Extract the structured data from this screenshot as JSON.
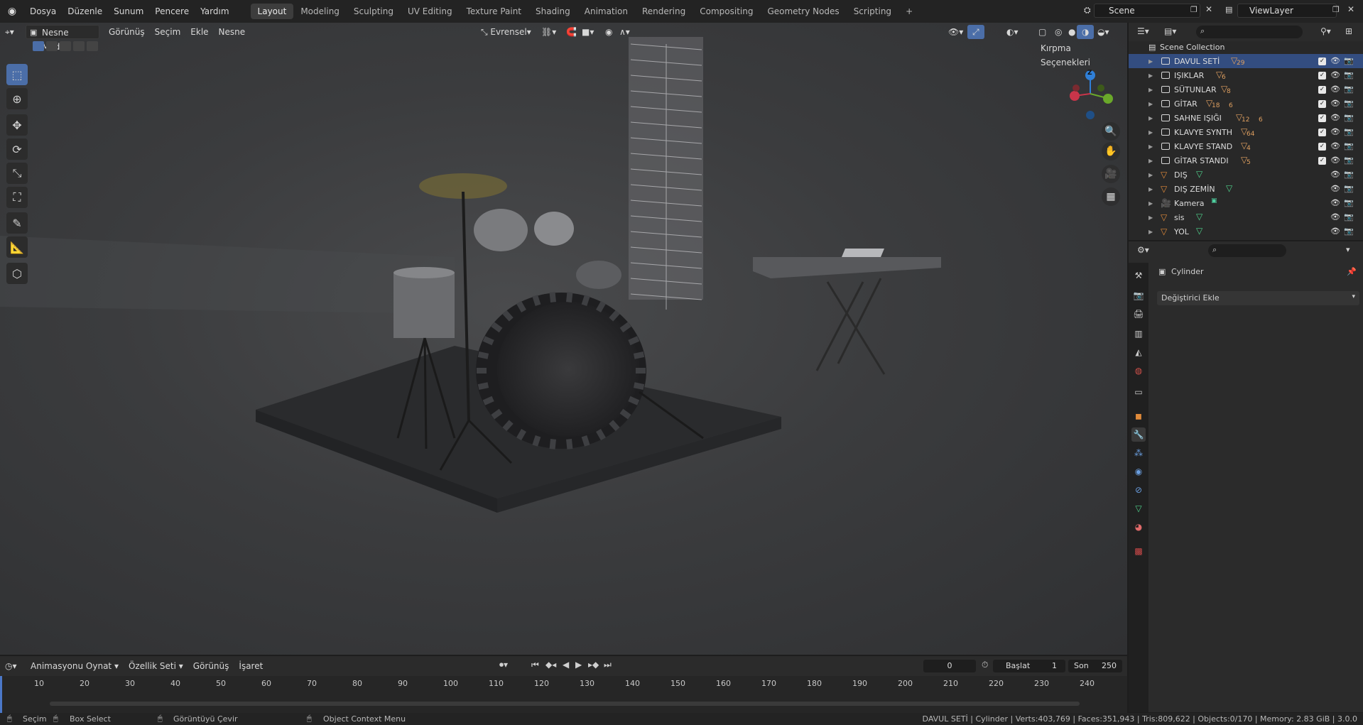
{
  "topbar": {
    "menus": [
      "Dosya",
      "Düzenle",
      "Sunum",
      "Pencere",
      "Yardım"
    ],
    "workspaces": [
      "Layout",
      "Modeling",
      "Sculpting",
      "UV Editing",
      "Texture Paint",
      "Shading",
      "Animation",
      "Rendering",
      "Compositing",
      "Geometry Nodes",
      "Scripting"
    ],
    "active_workspace": "Layout",
    "add_tab": "+",
    "scene": "Scene",
    "view_layer": "ViewLayer"
  },
  "viewport": {
    "mode": "Nesne Modu",
    "menus": [
      "Görünüş",
      "Seçim",
      "Ekle",
      "Nesne"
    ],
    "orientation": "Evrensel",
    "clipping": "Kırpma Seçenekleri",
    "gizmo": {
      "z": "Z"
    }
  },
  "outliner": {
    "root": "Scene Collection",
    "items": [
      {
        "label": "DAVUL SETİ",
        "type": "collection",
        "badge": "29",
        "selected": true
      },
      {
        "label": "IŞIKLAR",
        "type": "collection",
        "badge": "6"
      },
      {
        "label": "SÜTUNLAR",
        "type": "collection",
        "badge": "8"
      },
      {
        "label": "GİTAR",
        "type": "collection",
        "badge": "18",
        "badge2": "6"
      },
      {
        "label": "SAHNE IŞIĞI",
        "type": "collection",
        "badge": "12",
        "badge2": "6"
      },
      {
        "label": "KLAVYE SYNTH",
        "type": "collection",
        "badge": "64"
      },
      {
        "label": "KLAVYE STAND",
        "type": "collection",
        "badge": "4"
      },
      {
        "label": "GİTAR STANDI",
        "type": "collection",
        "badge": "5"
      },
      {
        "label": "DIŞ",
        "type": "mesh"
      },
      {
        "label": "DIŞ ZEMİN",
        "type": "mesh"
      },
      {
        "label": "Kamera",
        "type": "camera"
      },
      {
        "label": "sis",
        "type": "mesh"
      },
      {
        "label": "YOL",
        "type": "mesh"
      }
    ]
  },
  "properties": {
    "object_name": "Cylinder",
    "add_modifier": "Değiştirici Ekle"
  },
  "timeline": {
    "menus": [
      "Animasyonu Oynat",
      "Özellik Seti",
      "Görünüş",
      "İşaret"
    ],
    "current_frame": "0",
    "start_label": "Başlat",
    "start": "1",
    "end_label": "Son",
    "end": "250",
    "ticks": [
      "10",
      "20",
      "30",
      "40",
      "50",
      "60",
      "70",
      "80",
      "90",
      "100",
      "110",
      "120",
      "130",
      "140",
      "150",
      "160",
      "170",
      "180",
      "190",
      "200",
      "210",
      "220",
      "230",
      "240"
    ]
  },
  "statusbar": {
    "select": "Seçim",
    "box_select": "Box Select",
    "rotate_view": "Görüntüyü Çevir",
    "context_menu": "Object Context Menu",
    "stats": "DAVUL SETİ | Cylinder | Verts:403,769 | Faces:351,943 | Tris:809,622 | Objects:0/170 | Memory: 2.83 GiB | 3.0.0"
  },
  "colors": {
    "accent": "#4b6ea8",
    "selected_row": "#334d80",
    "collection_badge": "#e0a060",
    "mesh_icon": "#4fd18b"
  }
}
